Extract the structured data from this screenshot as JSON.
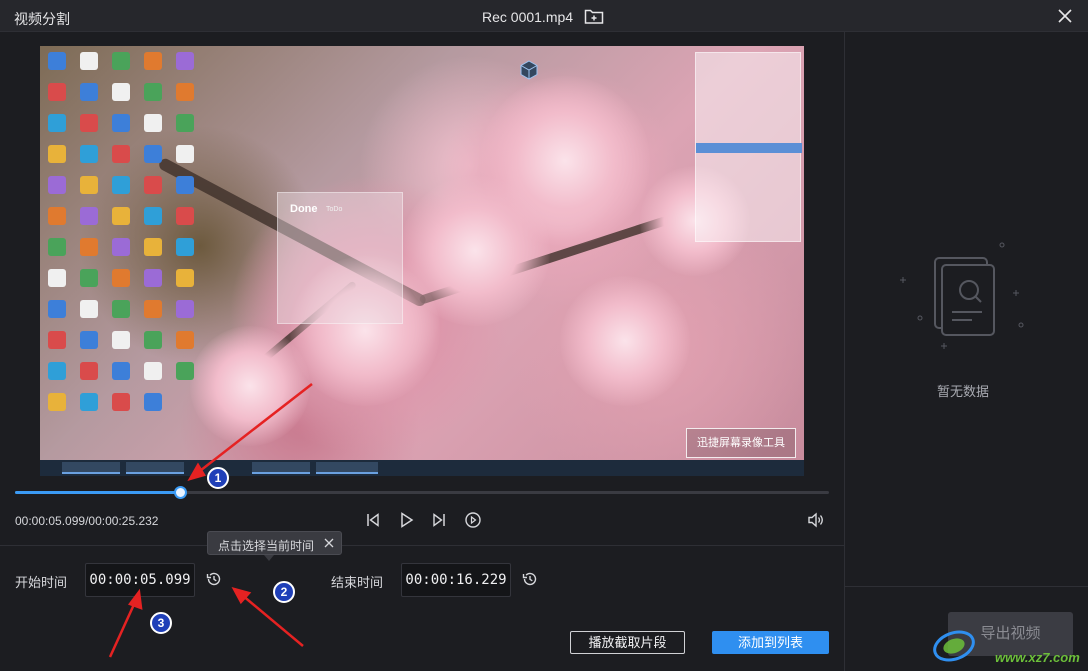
{
  "window": {
    "app_title": "视频分割",
    "file_name": "Rec 0001.mp4"
  },
  "icons": {
    "add_folder": "folder-plus-icon",
    "close": "close-icon",
    "prev": "skip-previous-icon",
    "play": "play-icon",
    "next": "skip-next-icon",
    "speed": "playback-speed-icon",
    "volume": "volume-icon",
    "set_current_time": "clock-rewind-icon",
    "empty": "empty-document-search-icon"
  },
  "player": {
    "progress": 0.2027,
    "current_time": "00:00:05.099",
    "total_time": "00:00:25.232",
    "time_readout": "00:00:05.099/00:00:25.232"
  },
  "video_frame": {
    "done_title": "Done",
    "done_subtitle": "ToDo",
    "watermark": "迅捷屏幕录像工具"
  },
  "tooltip": {
    "text": "点击选择当前时间"
  },
  "clip": {
    "start_label": "开始时间",
    "start_value": "00:00:05.099",
    "end_label": "结束时间",
    "end_value": "00:00:16.229"
  },
  "actions": {
    "play_clip": "播放截取片段",
    "add_to_list": "添加到列表"
  },
  "right_panel": {
    "empty_text": "暂无数据",
    "export_label": "导出视频"
  },
  "site_watermark": "www.xz7.com",
  "annotations": {
    "steps": [
      "1",
      "2",
      "3"
    ],
    "arrow_color": "#e52222"
  },
  "colors": {
    "accent": "#2f8ff0",
    "background": "#1c1d21"
  }
}
